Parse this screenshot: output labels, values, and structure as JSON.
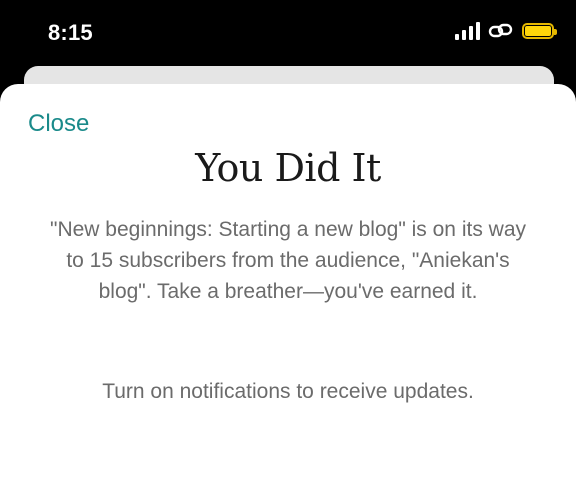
{
  "status_bar": {
    "time": "8:15",
    "battery_color": "#ffd60a"
  },
  "modal": {
    "close_label": "Close",
    "title": "You Did It",
    "message": "\"New beginnings: Starting a new blog\" is on its way to 15 subscribers from the audience, \"Aniekan's blog\". Take a breather—you've earned it.",
    "notification_prompt": "Turn on notifications to receive updates.",
    "accent_color": "#1a8a8a"
  }
}
